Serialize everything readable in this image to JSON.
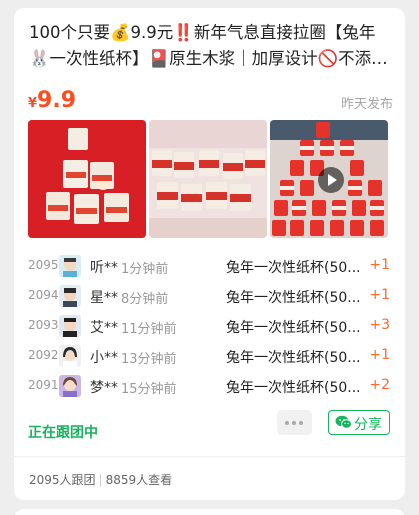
{
  "post": {
    "title": "100个只要💰9.9元‼️新年气息直接拉圈【兔年🐰一次性纸杯】🎴原生木浆｜加厚设计🚫不添加...",
    "currency": "¥",
    "price": "9.9",
    "posted": "昨天发布",
    "image_has_video": true
  },
  "records": [
    {
      "index": "2095",
      "name": "听**",
      "time": "1分钟前",
      "product": "兔年一次性纸杯(50...",
      "qty": "+1"
    },
    {
      "index": "2094",
      "name": "星**",
      "time": "8分钟前",
      "product": "兔年一次性纸杯(50...",
      "qty": "+1"
    },
    {
      "index": "2093",
      "name": "艾**",
      "time": "11分钟前",
      "product": "兔年一次性纸杯(50...",
      "qty": "+3"
    },
    {
      "index": "2092",
      "name": "小**",
      "time": "13分钟前",
      "product": "兔年一次性纸杯(50...",
      "qty": "+1"
    },
    {
      "index": "2091",
      "name": "梦**",
      "time": "15分钟前",
      "product": "兔年一次性纸杯(50...",
      "qty": "+2"
    }
  ],
  "footer": {
    "status": "正在跟团中",
    "share_label": "分享",
    "followers": "2095人跟团",
    "views": "8859人查看"
  },
  "colors": {
    "accent_green": "#17b35e",
    "price_orange": "#ff4d1f",
    "qty_orange": "#ff6b2c"
  },
  "icons": [
    "more-icon",
    "wechat-icon",
    "play-icon"
  ]
}
